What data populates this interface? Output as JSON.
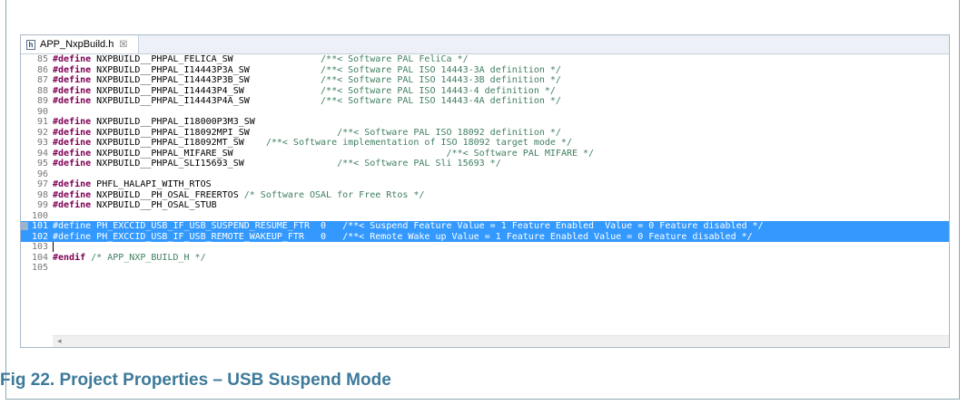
{
  "editor": {
    "tab_label": "APP_NxpBuild.h",
    "tab_close": "☒",
    "file_icon": "h"
  },
  "lines": [
    {
      "no": "85",
      "kw": "#define",
      "name": " NXPBUILD__PHPAL_FELICA_SW",
      "pad": "                ",
      "comment": "/**< Software PAL FeliCa */"
    },
    {
      "no": "86",
      "kw": "#define",
      "name": " NXPBUILD__PHPAL_I14443P3A_SW",
      "pad": "             ",
      "comment": "/**< Software PAL ISO 14443-3A definition */"
    },
    {
      "no": "87",
      "kw": "#define",
      "name": " NXPBUILD__PHPAL_I14443P3B_SW",
      "pad": "             ",
      "comment": "/**< Software PAL ISO 14443-3B definition */"
    },
    {
      "no": "88",
      "kw": "#define",
      "name": " NXPBUILD__PHPAL_I14443P4_SW",
      "pad": "              ",
      "comment": "/**< Software PAL ISO 14443-4 definition */"
    },
    {
      "no": "89",
      "kw": "#define",
      "name": " NXPBUILD__PHPAL_I14443P4A_SW",
      "pad": "             ",
      "comment": "/**< Software PAL ISO 14443-4A definition */"
    },
    {
      "no": "90",
      "kw": "",
      "name": "",
      "pad": "",
      "comment": ""
    },
    {
      "no": "91",
      "kw": "#define",
      "name": " NXPBUILD__PHPAL_I18000P3M3_SW",
      "pad": "",
      "comment": ""
    },
    {
      "no": "92",
      "kw": "#define",
      "name": " NXPBUILD__PHPAL_I18092MPI_SW",
      "pad": "                ",
      "comment": "/**< Software PAL ISO 18092 definition */"
    },
    {
      "no": "93",
      "kw": "#define",
      "name": " NXPBUILD__PHPAL_I18092MT_SW",
      "pad": "    ",
      "comment": "/**< Software implementation of ISO 18092 target mode */"
    },
    {
      "no": "94",
      "kw": "#define",
      "name": " NXPBUILD__PHPAL_MIFARE_SW",
      "pad": "                                       ",
      "comment": "/**< Software PAL MIFARE */"
    },
    {
      "no": "95",
      "kw": "#define",
      "name": " NXPBUILD__PHPAL_SLI15693_SW",
      "pad": "                 ",
      "comment": "/**< Software PAL Sli 15693 */"
    },
    {
      "no": "96",
      "kw": "",
      "name": "",
      "pad": "",
      "comment": ""
    },
    {
      "no": "97",
      "kw": "#define",
      "name": " PHFL_HALAPI_WITH_RTOS",
      "pad": "",
      "comment": ""
    },
    {
      "no": "98",
      "kw": "#define",
      "name": " NXPBUILD__PH_OSAL_FREERTOS",
      "pad": " ",
      "comment": "/* Software OSAL for Free Rtos */"
    },
    {
      "no": "99",
      "kw": "#define",
      "name": " NXPBUILD__PH_OSAL_STUB",
      "pad": "",
      "comment": ""
    },
    {
      "no": "100",
      "kw": "",
      "name": "",
      "pad": "",
      "comment": ""
    },
    {
      "no": "101",
      "kw": "#define",
      "name": " PH_EXCCID_USB_IF_USB_SUSPEND_RESUME_FTR  0",
      "pad": "   ",
      "comment": "/**< Suspend Feature Value = 1 Feature Enabled  Value = 0 Feature disabled */",
      "selected": true
    },
    {
      "no": "102",
      "kw": "#define",
      "name": " PH_EXCCID_USB_IF_USB_REMOTE_WAKEUP_FTR   0",
      "pad": "   ",
      "comment": "/**< Remote Wake up Value = 1 Feature Enabled Value = 0 Feature disabled */",
      "selected": true
    },
    {
      "no": "103",
      "kw": "",
      "name": "",
      "pad": "",
      "comment": ""
    },
    {
      "no": "104",
      "kw": "#endif",
      "name": " ",
      "pad": "",
      "comment": "/* APP_NXP_BUILD_H */"
    },
    {
      "no": "105",
      "kw": "",
      "name": "",
      "pad": "",
      "comment": ""
    }
  ],
  "caption": "Fig 22.   Project Properties – USB Suspend Mode"
}
